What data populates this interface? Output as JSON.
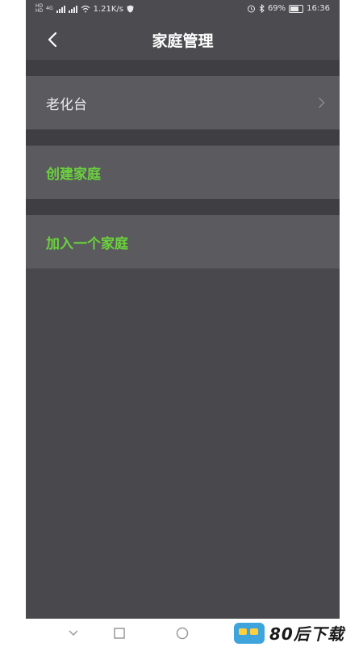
{
  "status_bar": {
    "network_speed": "1.21K/s",
    "battery": "69%",
    "time": "16:36",
    "sim1_tag": "HD",
    "sim2_tag": "HD",
    "net_type": "4G"
  },
  "nav": {
    "title": "家庭管理"
  },
  "families": [
    {
      "label": "老化台"
    }
  ],
  "actions": {
    "create": "创建家庭",
    "join": "加入一个家庭"
  },
  "colors": {
    "accent_green": "#6bd33c",
    "background": "#49484d",
    "row_background": "#5b5a5f"
  },
  "watermark": {
    "text": "80后下载"
  }
}
